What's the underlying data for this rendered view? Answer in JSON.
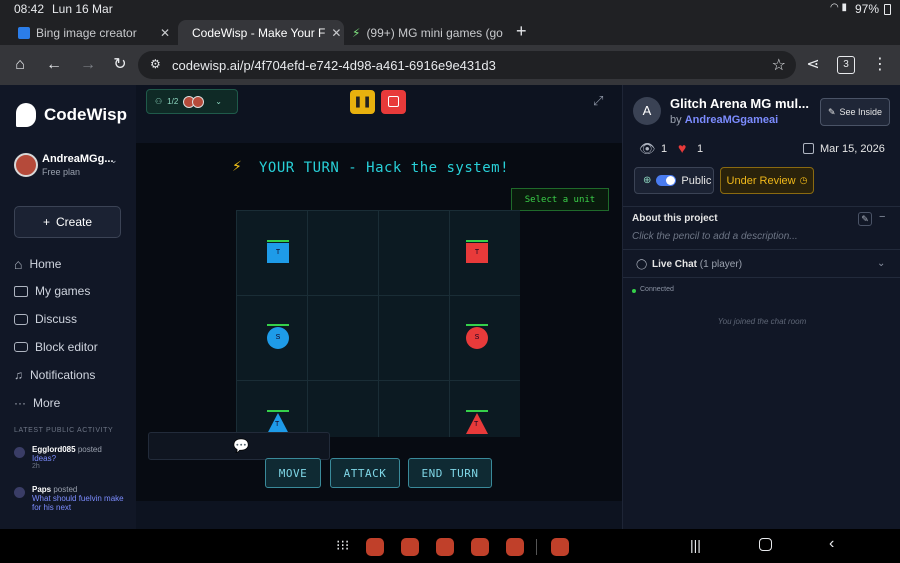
{
  "status_bar": {
    "time": "08:42",
    "date": "Lun 16 Mar",
    "battery": "97%"
  },
  "tabs": [
    {
      "label": "Bing image creator",
      "favicon_color": "#2b7de9"
    },
    {
      "label": "CodeWisp - Make Your F",
      "favicon_color": "#ffffff"
    },
    {
      "label": "(99+) MG mini games (go",
      "favicon_color": "#7ee07e"
    }
  ],
  "toolbar": {
    "url": "codewisp.ai/p/4f704efd-e742-4d98-a461-6916e9e431d3",
    "tab_count": "3"
  },
  "sidebar": {
    "brand": "CodeWisp",
    "user_name": "AndreaMGg...",
    "user_plan": "Free plan",
    "create_label": "Create",
    "nav": [
      {
        "label": "Home",
        "icon": "home-icon"
      },
      {
        "label": "My games",
        "icon": "folder-icon"
      },
      {
        "label": "Discuss",
        "icon": "chat-icon"
      },
      {
        "label": "Block editor",
        "icon": "blocks-icon"
      },
      {
        "label": "Notifications",
        "icon": "bell-icon"
      },
      {
        "label": "More",
        "icon": "more-icon"
      }
    ],
    "activity_heading": "LATEST PUBLIC ACTIVITY",
    "activity": [
      {
        "user": "Egglord085",
        "verb": "posted",
        "title": "Ideas?",
        "time": "2h"
      },
      {
        "user": "Paps",
        "verb": "posted",
        "title": "What should fuelvin make for his next",
        "time": ""
      }
    ]
  },
  "game": {
    "players": "1/2",
    "turn_text": "YOUR TURN - Hack the system!",
    "hint": "Select a unit",
    "unit_label_square": "T",
    "unit_label_circle": "S",
    "unit_label_triangle": "T",
    "buttons": {
      "move": "MOVE",
      "attack": "ATTACK",
      "end_turn": "END TURN"
    },
    "colors": {
      "blue": "#1e9be8",
      "red": "#e83a3a"
    }
  },
  "project": {
    "avatar_letter": "A",
    "title": "Glitch Arena MG mul...",
    "by_prefix": "by",
    "author": "AndreaMGgameai",
    "see_inside_label": "See Inside",
    "views": "1",
    "likes": "1",
    "date": "Mar 15, 2026",
    "visibility": "Public",
    "review_status": "Under Review",
    "about_heading": "About this project",
    "about_placeholder": "Click the pencil to add a description...",
    "chat_heading": "Live Chat",
    "chat_count": "(1 player)",
    "chat_status": "Connected",
    "chat_message": "You joined the chat room"
  }
}
